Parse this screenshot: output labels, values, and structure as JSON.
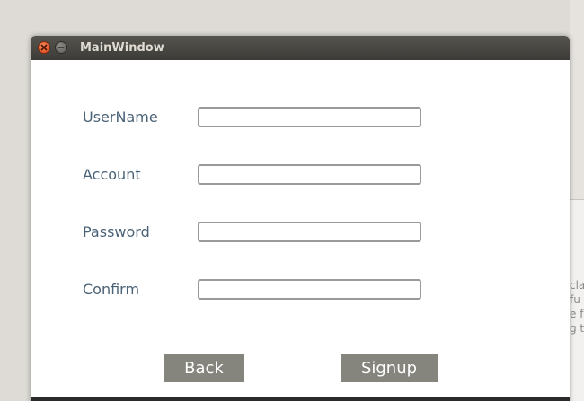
{
  "window": {
    "title": "MainWindow"
  },
  "form": {
    "username_label": "UserName",
    "username_value": "",
    "account_label": "Account",
    "account_value": "",
    "password_label": "Password",
    "password_value": "",
    "confirm_label": "Confirm",
    "confirm_value": ""
  },
  "buttons": {
    "back_label": "Back",
    "signup_label": "Signup"
  },
  "background_app": {
    "text_lines": [
      "cla",
      "fu",
      "e fu",
      "g t"
    ]
  },
  "colors": {
    "titlebar": "#3c3b37",
    "label_text": "#4a6277",
    "button_bg": "#85857e",
    "close_button": "#e4562a"
  }
}
